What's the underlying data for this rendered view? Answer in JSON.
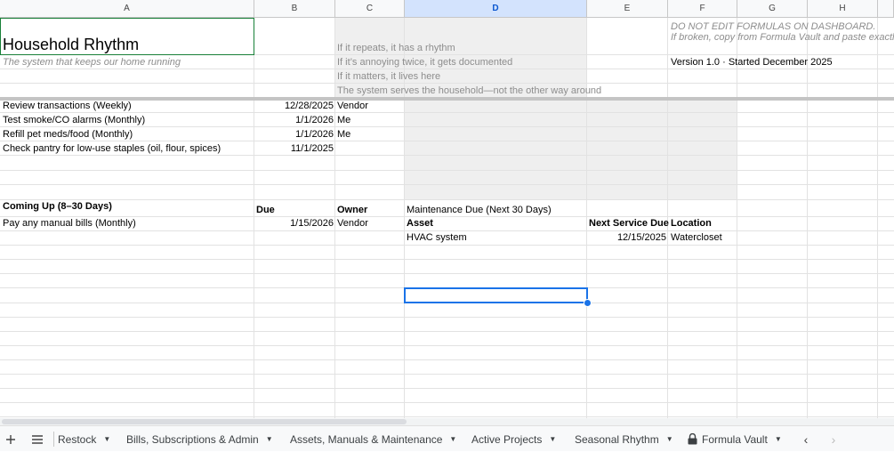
{
  "columns": [
    "A",
    "B",
    "C",
    "D",
    "E",
    "F",
    "G",
    "H"
  ],
  "selected_column": "D",
  "header": {
    "title": "Household Rhythm",
    "subtitle": "The system that keeps our home running",
    "principles": [
      "If it repeats, it has a rhythm",
      "If it’s annoying twice, it gets documented",
      "If it matters, it lives here",
      "The system serves the household—not the other way around"
    ],
    "warning_line1": "DO NOT EDIT FORMULAS ON DASHBOARD.",
    "warning_line2": "If broken, copy from Formula Vault and paste exactly.",
    "version": "Version 1.0 · Started December 2025"
  },
  "due_tasks": [
    {
      "task": "Review transactions (Weekly)",
      "due": "12/28/2025",
      "owner": "Vendor"
    },
    {
      "task": "Test smoke/CO alarms (Monthly)",
      "due": "1/1/2026",
      "owner": "Me"
    },
    {
      "task": "Refill pet meds/food (Monthly)",
      "due": "1/1/2026",
      "owner": "Me"
    },
    {
      "task": "Check pantry for low-use staples (oil, flour, spices)",
      "due": "11/1/2025",
      "owner": ""
    }
  ],
  "coming_up": {
    "title": "Coming Up (8–30 Days)",
    "due_header": "Due",
    "owner_header": "Owner",
    "rows": [
      {
        "task": "Pay any manual bills (Monthly)",
        "due": "1/15/2026",
        "owner": "Vendor"
      }
    ]
  },
  "maintenance": {
    "title": "Maintenance Due (Next 30 Days)",
    "asset_header": "Asset",
    "next_service_header": "Next Service Due",
    "location_header": "Location",
    "rows": [
      {
        "asset": "HVAC system",
        "next_service": "12/15/2025",
        "location": "Watercloset"
      }
    ]
  },
  "tabs": [
    {
      "label": "Restock",
      "locked": false
    },
    {
      "label": "Bills, Subscriptions & Admin",
      "locked": false
    },
    {
      "label": "Assets, Manuals & Maintenance",
      "locked": false
    },
    {
      "label": "Active Projects",
      "locked": false
    },
    {
      "label": "Seasonal Rhythm",
      "locked": false
    },
    {
      "label": "Formula Vault",
      "locked": true
    }
  ],
  "icons": {
    "add_sheet": "plus-icon",
    "all_sheets": "menu-icon",
    "scroll_left": "chevron-left-icon",
    "scroll_right": "chevron-right-icon",
    "lock": "lock-icon",
    "tab_menu": "caret-down-icon"
  },
  "colors": {
    "selection": "#1a73e8",
    "header_bg": "#f8f9fa",
    "selected_header_bg": "#d3e3fd",
    "shaded_cells": "#efefef",
    "muted_text": "#8d8d8d",
    "title_border": "#188038"
  }
}
